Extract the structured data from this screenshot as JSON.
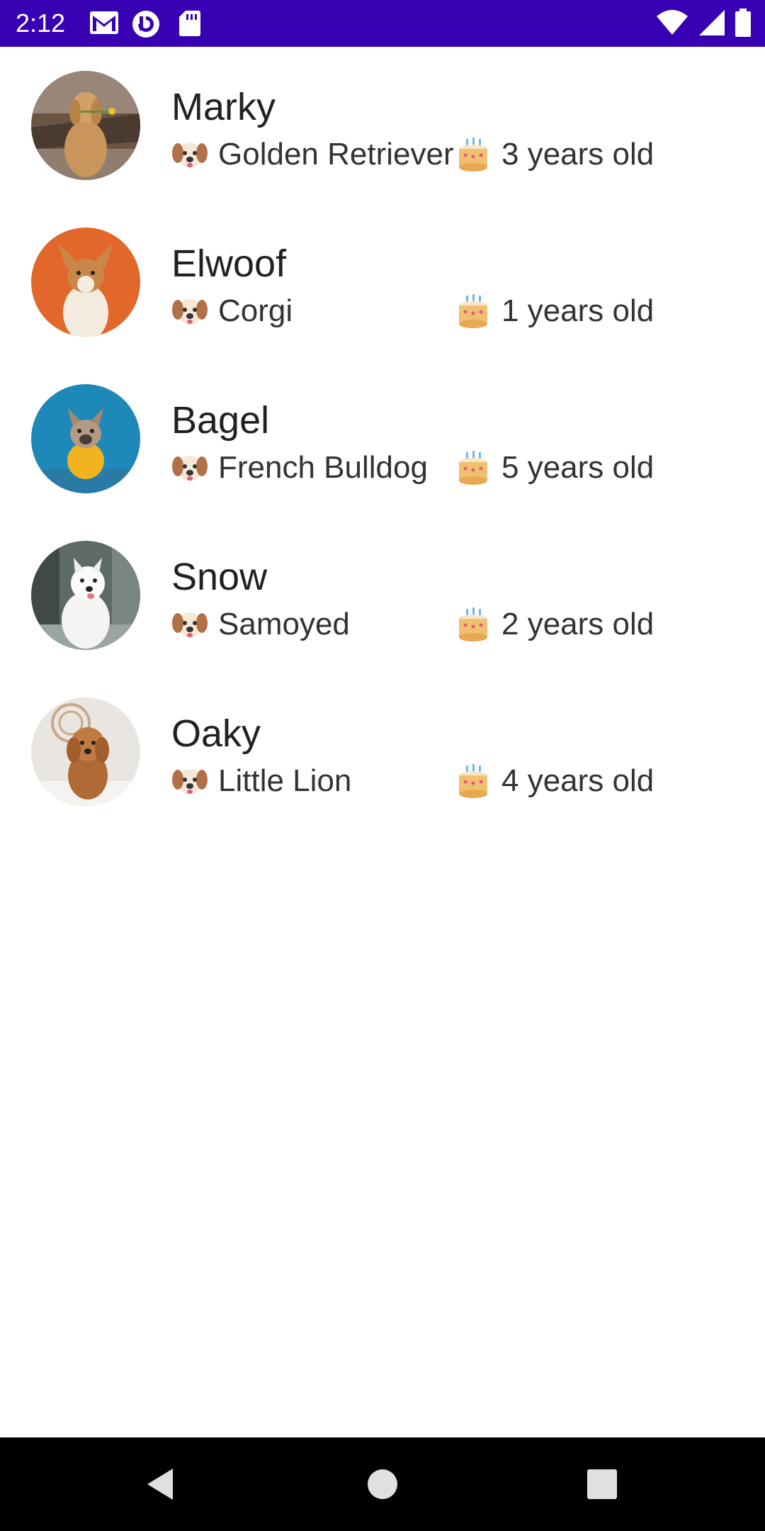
{
  "status_bar": {
    "time": "2:12",
    "background": "#3700b3",
    "left_icons": [
      "gmail-icon",
      "pocket-casts-icon",
      "sd-card-icon"
    ],
    "right_icons": [
      "wifi-icon",
      "signal-icon",
      "battery-icon"
    ]
  },
  "dogs": [
    {
      "name": "Marky",
      "breed": "Golden Retriever",
      "age": "3 years old",
      "avatar_bg": "#8a6a4f"
    },
    {
      "name": "Elwoof",
      "breed": "Corgi",
      "age": "1 years old",
      "avatar_bg": "#e2672b"
    },
    {
      "name": "Bagel",
      "breed": "French Bulldog",
      "age": "5 years old",
      "avatar_bg": "#1e88b8"
    },
    {
      "name": "Snow",
      "breed": "Samoyed",
      "age": "2 years old",
      "avatar_bg": "#7e8a86"
    },
    {
      "name": "Oaky",
      "breed": "Little Lion",
      "age": "4 years old",
      "avatar_bg": "#e9e6e2"
    }
  ],
  "nav_bar": {
    "buttons": [
      "back-icon",
      "home-icon",
      "recents-icon"
    ]
  }
}
